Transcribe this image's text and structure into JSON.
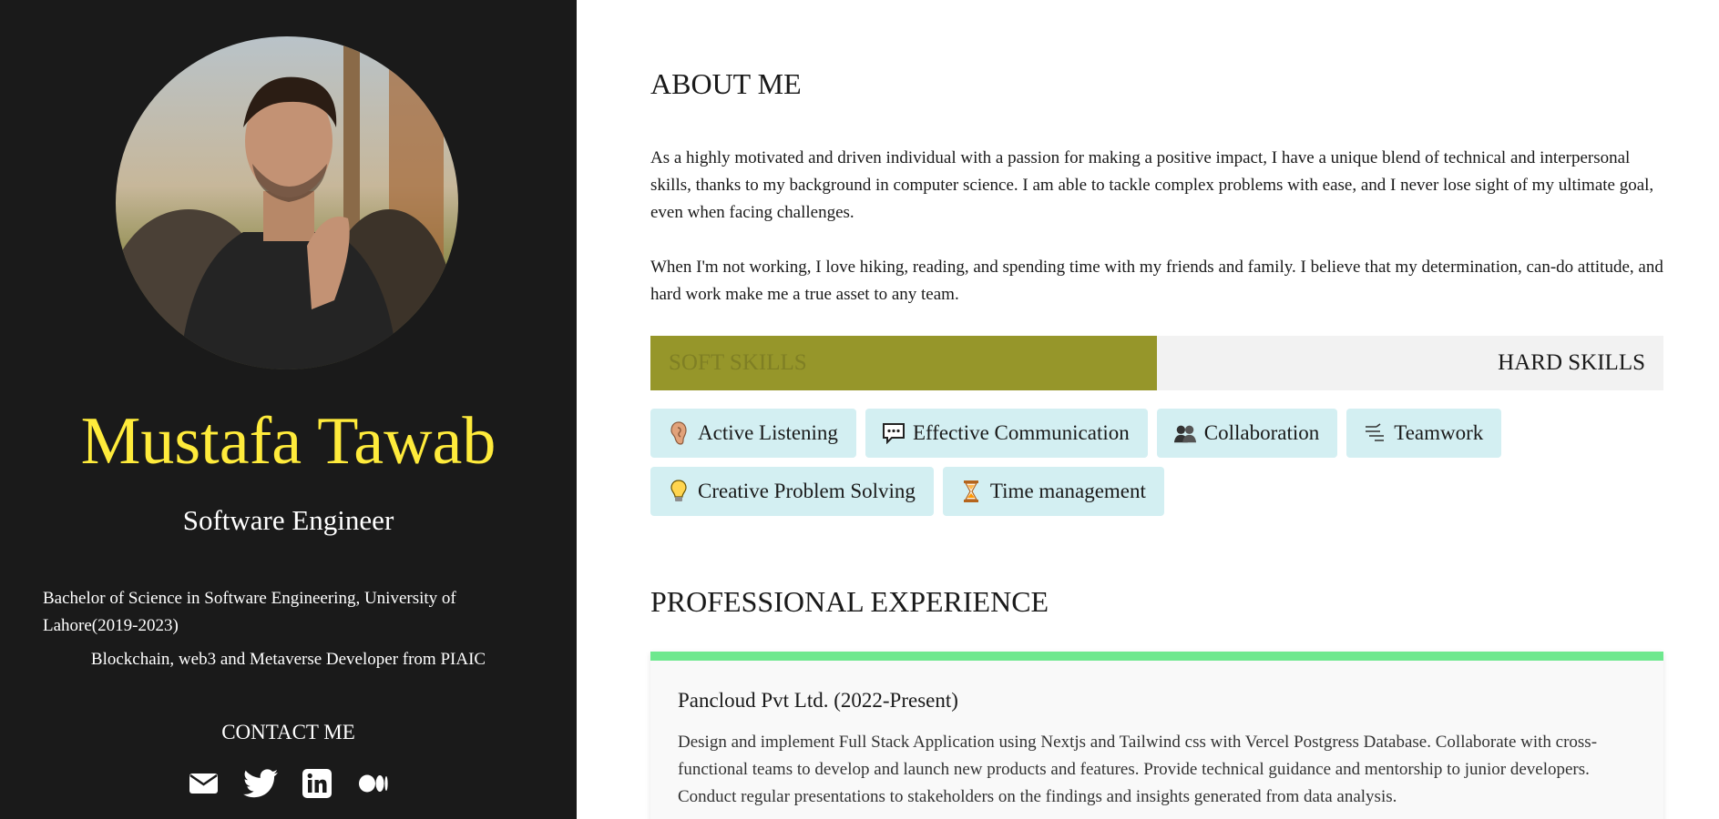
{
  "profile": {
    "name": "Mustafa Tawab",
    "role": "Software Engineer",
    "education": "Bachelor of Science in Software Engineering, University of Lahore(2019-2023)",
    "certification": "Blockchain, web3 and Metaverse Developer from PIAIC",
    "contact_title": "CONTACT ME",
    "socials": [
      "email-icon",
      "twitter-icon",
      "linkedin-icon",
      "medium-icon"
    ]
  },
  "about": {
    "title": "ABOUT ME",
    "paragraph1": "As a highly motivated and driven individual with a passion for making a positive impact, I have a unique blend of technical and interpersonal skills, thanks to my background in computer science. I am able to tackle complex problems with ease, and I never lose sight of my ultimate goal, even when facing challenges.",
    "paragraph2": "When I'm not working, I love hiking, reading, and spending time with my friends and family. I believe that my determination, can-do attitude, and hard work make me a true asset to any team."
  },
  "skills": {
    "tabs": [
      "SOFT SKILLS",
      "HARD SKILLS"
    ],
    "active_tab": "SOFT SKILLS",
    "items": [
      {
        "label": "Active Listening",
        "icon": "ear-icon"
      },
      {
        "label": "Effective Communication",
        "icon": "speech-bubble-icon"
      },
      {
        "label": "Collaboration",
        "icon": "people-icon"
      },
      {
        "label": "Teamwork",
        "icon": "teamwork-icon"
      },
      {
        "label": "Creative Problem Solving",
        "icon": "lightbulb-icon"
      },
      {
        "label": "Time management",
        "icon": "hourglass-icon"
      }
    ]
  },
  "experience": {
    "title": "PROFESSIONAL EXPERIENCE",
    "jobs": [
      {
        "heading": "Pancloud Pvt Ltd. (2022-Present)",
        "description": "Design and implement Full Stack Application using Nextjs and Tailwind css with Vercel Postgress Database. Collaborate with cross-functional teams to develop and launch new products and features. Provide technical guidance and mentorship to junior developers. Conduct regular presentations to stakeholders on the findings and insights generated from data analysis."
      }
    ]
  },
  "colors": {
    "sidebar_bg": "#1a1a1a",
    "name": "#ffeb3b",
    "soft_tab_bg": "#96962a",
    "chip_bg": "#d3eff2",
    "card_accent": "#6ee88e"
  }
}
